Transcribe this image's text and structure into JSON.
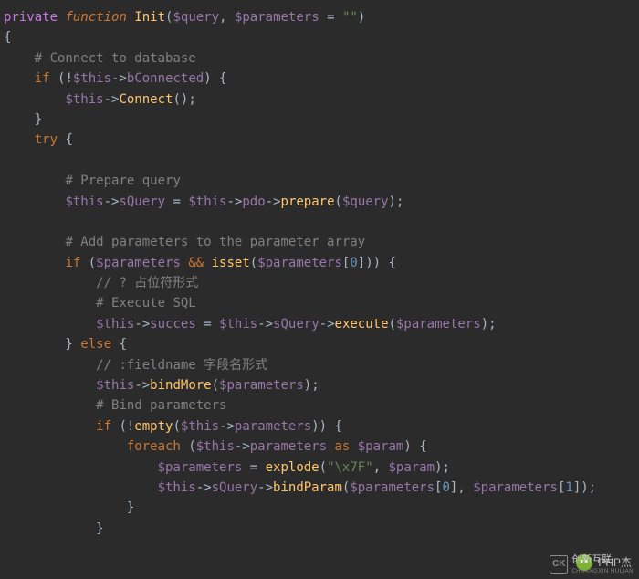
{
  "code": {
    "line01": {
      "private": "private",
      "function": "function",
      "fn": "Init",
      "p1": "$query",
      "p2": "$parameters",
      "eq": "=",
      "empty": "\"\""
    },
    "line02": "{",
    "line03_comment": "# Connect to database",
    "line04": {
      "if": "if",
      "not": "!",
      "this": "$this",
      "arrow": "->",
      "prop": "bConnected"
    },
    "line05": {
      "this": "$this",
      "arrow": "->",
      "method": "Connect"
    },
    "line06": "}",
    "line07": {
      "try": "try"
    },
    "line09_comment": "# Prepare query",
    "line10": {
      "this": "$this",
      "arrow": "->",
      "sQuery": "sQuery",
      "eq": "=",
      "this2": "$this",
      "pdo": "pdo",
      "prepare": "prepare",
      "q": "$query"
    },
    "line12_comment": "# Add parameters to the parameter array",
    "line13": {
      "if": "if",
      "p": "$parameters",
      "and": "&&",
      "isset": "isset",
      "zero": "0"
    },
    "line14_comment": "// ? 占位符形式",
    "line15_comment": "# Execute SQL",
    "line16": {
      "this": "$this",
      "arrow": "->",
      "succes": "succes",
      "eq": "=",
      "sQuery": "sQuery",
      "execute": "execute",
      "p": "$parameters"
    },
    "line17": {
      "else": "else"
    },
    "line18_comment": "// :fieldname 字段名形式",
    "line19": {
      "this": "$this",
      "arrow": "->",
      "bindMore": "bindMore",
      "p": "$parameters"
    },
    "line20_comment": "# Bind parameters",
    "line21": {
      "if": "if",
      "not": "!",
      "empty": "empty",
      "this": "$this",
      "arrow": "->",
      "parameters": "parameters"
    },
    "line22": {
      "foreach": "foreach",
      "this": "$this",
      "arrow": "->",
      "parameters": "parameters",
      "as": "as",
      "param": "$param"
    },
    "line23": {
      "p": "$parameters",
      "eq": "=",
      "explode": "explode",
      "sep": "\"\\x7F\"",
      "param": "$param"
    },
    "line24": {
      "this": "$this",
      "arrow": "->",
      "sQuery": "sQuery",
      "bindParam": "bindParam",
      "p": "$parameters",
      "zero": "0",
      "one": "1"
    },
    "line25": "}",
    "line26": "}"
  },
  "watermark": {
    "wechat_text": "PHP杰",
    "brand": "创新互联",
    "brand_sub": "CHUANGXIN HULIAN"
  }
}
